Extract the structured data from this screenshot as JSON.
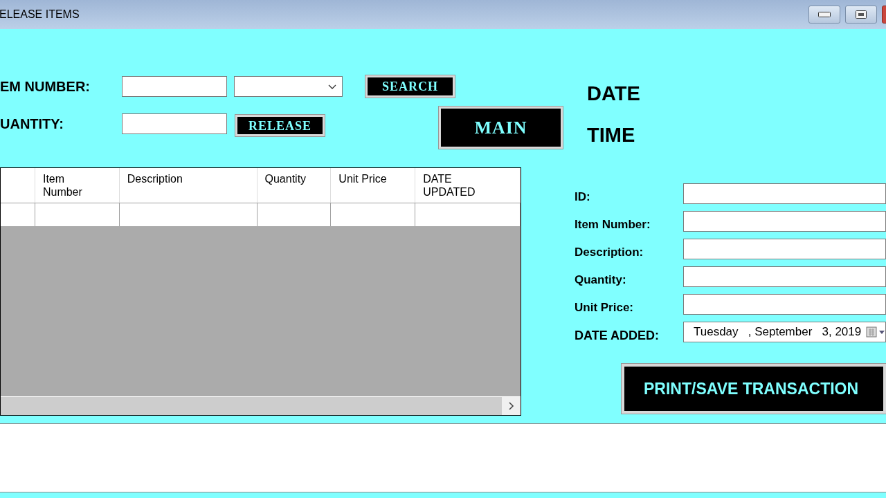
{
  "window": {
    "title": "ELEASE ITEMS"
  },
  "search_row": {
    "label": "EM NUMBER:",
    "button": "SEARCH"
  },
  "release_row": {
    "label": "UANTITY:",
    "button": "RELEASE"
  },
  "main_button": "MAIN",
  "date_label": "DATE",
  "time_label": "TIME",
  "grid": {
    "columns": [
      "Item\nNumber",
      "Description",
      "Quantity",
      "Unit Price",
      "DATE\nUPDATED"
    ]
  },
  "details": {
    "fields": [
      {
        "label": "ID:"
      },
      {
        "label": "Item Number:"
      },
      {
        "label": "Description:"
      },
      {
        "label": "Quantity:"
      },
      {
        "label": "Unit Price:"
      }
    ],
    "date_label": "DATE ADDED:",
    "date_value": "Tuesday   , September   3, 2019"
  },
  "print_button": "PRINT/SAVE TRANSACTION"
}
